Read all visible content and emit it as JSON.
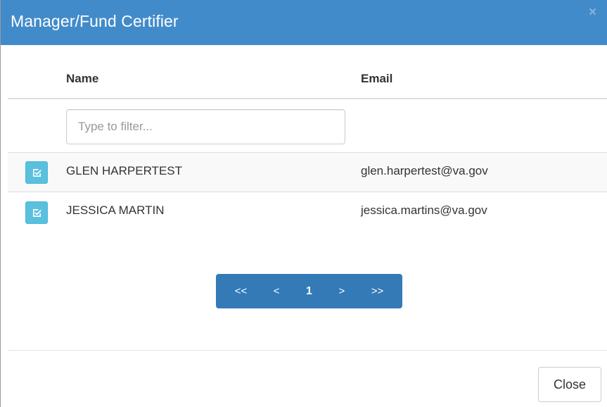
{
  "dialog": {
    "title": "Manager/Fund Certifier",
    "close_glyph": "×"
  },
  "table": {
    "columns": [
      "Name",
      "Email"
    ],
    "filter_placeholder": "Type to filter...",
    "rows": [
      {
        "name": "GLEN HARPERTEST",
        "email": "glen.harpertest@va.gov"
      },
      {
        "name": "JESSICA MARTIN",
        "email": "jessica.martins@va.gov"
      }
    ]
  },
  "pagination": {
    "first": "<<",
    "prev": "<",
    "current": "1",
    "next": ">",
    "last": ">>"
  },
  "footer": {
    "close_label": "Close"
  },
  "colors": {
    "header_bg": "#428bca",
    "select_button": "#5bc0de",
    "pager_bg": "#337ab7"
  },
  "icons": {
    "row_select": "check-square-icon",
    "dialog_close": "close-icon"
  }
}
